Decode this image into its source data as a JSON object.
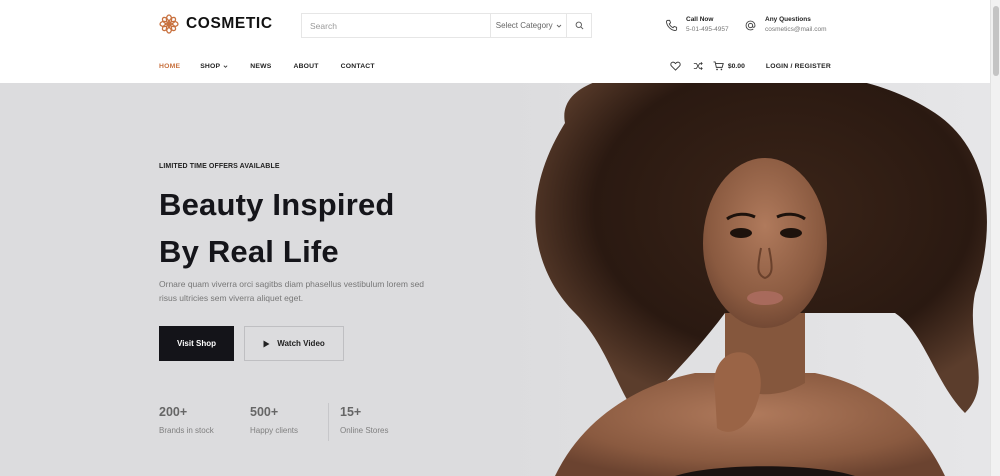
{
  "header": {
    "logo_text": "COSMETIC",
    "search": {
      "placeholder": "Search",
      "category_label": "Select Category"
    },
    "phone": {
      "label": "Call Now",
      "value": "5-01-495-4957"
    },
    "email": {
      "label": "Any Questions",
      "value": "cosmetics@mail.com"
    }
  },
  "nav": {
    "items": [
      {
        "label": "HOME",
        "active": true
      },
      {
        "label": "SHOP",
        "dropdown": true
      },
      {
        "label": "NEWS"
      },
      {
        "label": "ABOUT"
      },
      {
        "label": "CONTACT"
      }
    ],
    "cart_total": "$0.00",
    "login_label": "LOGIN / REGISTER"
  },
  "hero": {
    "eyebrow": "LIMITED TIME OFFERS AVAILABLE",
    "headline_line1": "Beauty Inspired",
    "headline_line2": "By Real Life",
    "description": "Ornare quam viverra orci sagitbs diam phasellus vestibulum lorem sed risus ultricies sem viverra aliquet eget.",
    "primary_button": "Visit Shop",
    "secondary_button": "Watch Video",
    "stats": [
      {
        "value": "200+",
        "label": "Brands in stock"
      },
      {
        "value": "500+",
        "label": "Happy clients"
      },
      {
        "value": "15+",
        "label": "Online Stores"
      }
    ]
  },
  "colors": {
    "accent": "#c8713f",
    "hero_bg": "#dcdcde",
    "dark_button": "#141419"
  },
  "icons": [
    "flower-logo-icon",
    "search-icon",
    "chevron-down-icon",
    "phone-icon",
    "at-icon",
    "heart-icon",
    "shuffle-icon",
    "cart-icon",
    "play-icon"
  ]
}
